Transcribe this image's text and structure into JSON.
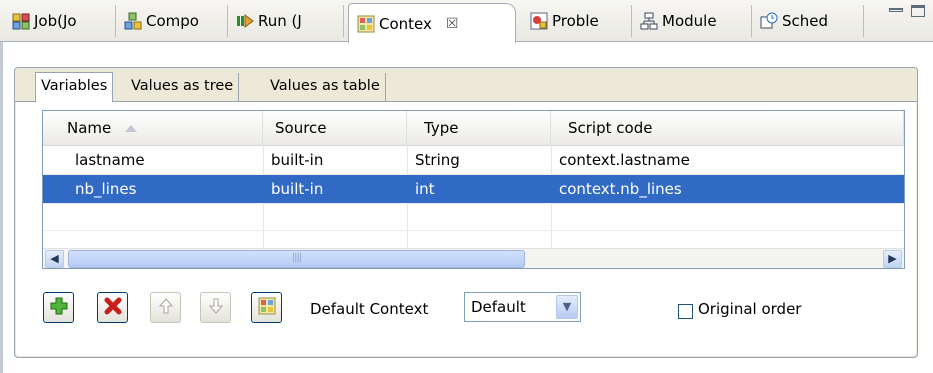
{
  "view_tabs": [
    {
      "label": "Job(Jo",
      "icon": "job-icon"
    },
    {
      "label": "Compo",
      "icon": "component-icon"
    },
    {
      "label": "Run (J",
      "icon": "run-icon"
    },
    {
      "label": "Contex",
      "icon": "context-icon"
    },
    {
      "label": "Proble",
      "icon": "problems-icon"
    },
    {
      "label": "Module",
      "icon": "modules-icon"
    },
    {
      "label": "Sched",
      "icon": "scheduler-icon"
    }
  ],
  "active_view_close": "☒",
  "inner_tabs": [
    {
      "label": "Variables"
    },
    {
      "label": "Values as tree"
    },
    {
      "label": "Values as table"
    }
  ],
  "table": {
    "columns": [
      {
        "label": "Name"
      },
      {
        "label": "Source"
      },
      {
        "label": "Type"
      },
      {
        "label": "Script code"
      }
    ],
    "rows": [
      {
        "name": "lastname",
        "source": "built-in",
        "type": "String",
        "script": "context.lastname"
      },
      {
        "name": "nb_lines",
        "source": "built-in",
        "type": "int",
        "script": "context.nb_lines"
      }
    ],
    "scroll_grip": "||||"
  },
  "toolbar": {
    "default_context_label": "Default Context",
    "context_value": "Default",
    "original_order_label": "Original order"
  },
  "colors": {
    "selection": "#316ac5",
    "accent_border": "#003c74"
  }
}
